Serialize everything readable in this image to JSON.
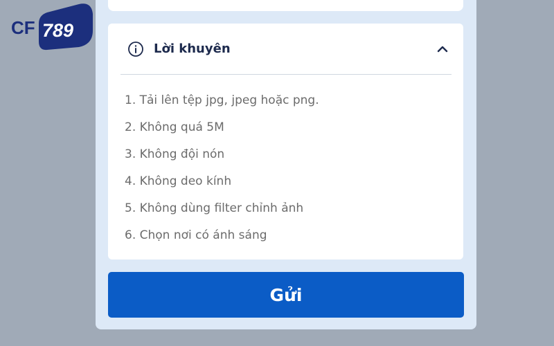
{
  "logo": {
    "prefix": "CF",
    "number": "789"
  },
  "advice": {
    "icon": "info-icon",
    "title": "Lời khuyên",
    "toggle_icon": "chevron-up-icon",
    "tips": [
      "1. Tải lên tệp jpg, jpeg hoặc png.",
      "2. Không quá 5M",
      "3. Không đội nón",
      "4. Không deo kính",
      "5. Không dùng filter chỉnh ảnh",
      "6. Chọn nơi có ánh sáng"
    ]
  },
  "submit": {
    "label": "Gửi"
  },
  "colors": {
    "background": "#a0aab7",
    "panel": "#dde9f7",
    "card": "#ffffff",
    "primary": "#0b5cc6",
    "title_text": "#1d2a4d",
    "tip_text": "#6b6b6b",
    "logo_navy": "#1c2f7d"
  }
}
